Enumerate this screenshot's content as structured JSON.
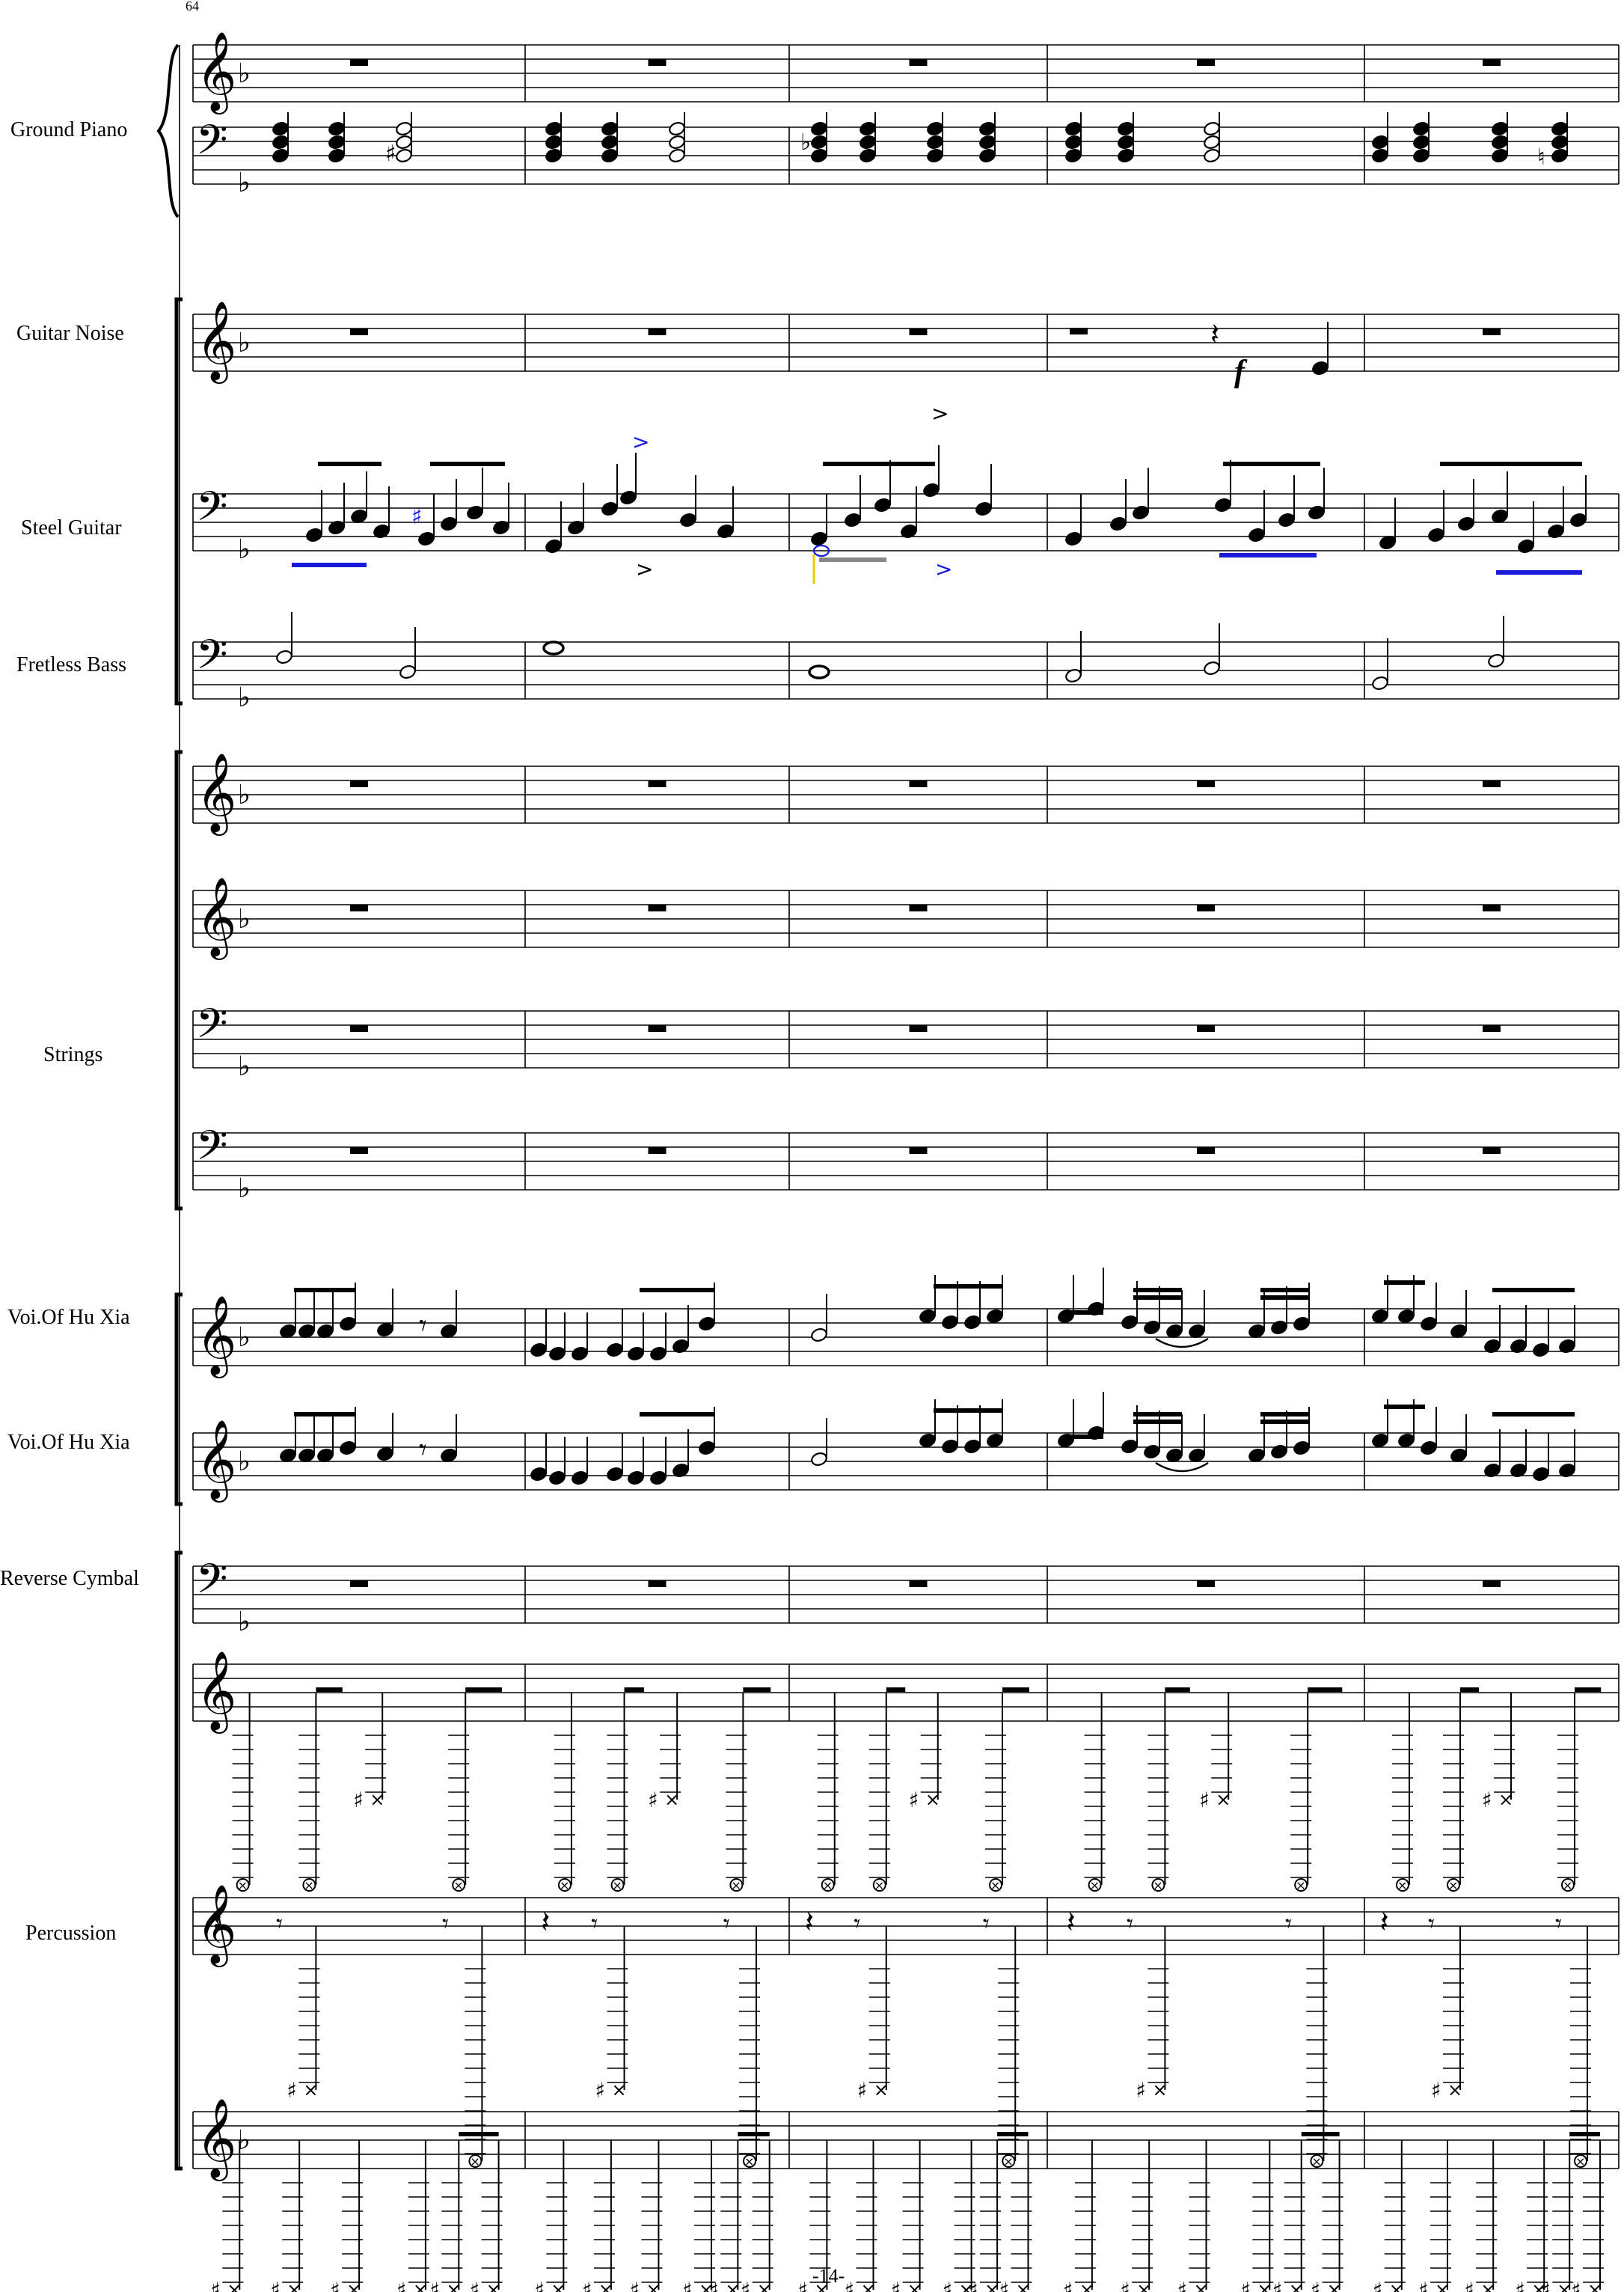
{
  "page": {
    "measure_number": "64",
    "page_number": "-14-",
    "key_signature": "F major (one flat)",
    "measures_shown": 5
  },
  "instruments": [
    {
      "label": "Ground Piano",
      "staves": [
        "treble",
        "bass"
      ]
    },
    {
      "label": "Guitar Noise",
      "staves": [
        "treble"
      ]
    },
    {
      "label": "Steel Guitar",
      "staves": [
        "bass"
      ]
    },
    {
      "label": "Fretless Bass",
      "staves": [
        "bass"
      ]
    },
    {
      "label": "Strings",
      "staves": [
        "treble",
        "treble",
        "bass",
        "bass"
      ]
    },
    {
      "label": "Voi.Of Hu Xia",
      "staves": [
        "treble"
      ]
    },
    {
      "label": "Voi.Of Hu Xia",
      "staves": [
        "treble"
      ]
    },
    {
      "label": "Reverse Cymbal",
      "staves": [
        "bass"
      ]
    },
    {
      "label": "Percussion",
      "staves": [
        "treble",
        "treble",
        "treble"
      ]
    }
  ],
  "dynamics": {
    "guitar_noise_m4": "f"
  },
  "colors": {
    "ink": "#000000",
    "accent_blue": "#1a1adb",
    "accent_gray": "#888888",
    "accent_yellow": "#e6d000"
  },
  "clef_glyphs": {
    "treble": "𝄞",
    "bass": "𝄢",
    "flat": "♭",
    "sharp": "♯",
    "natural": "♮"
  }
}
